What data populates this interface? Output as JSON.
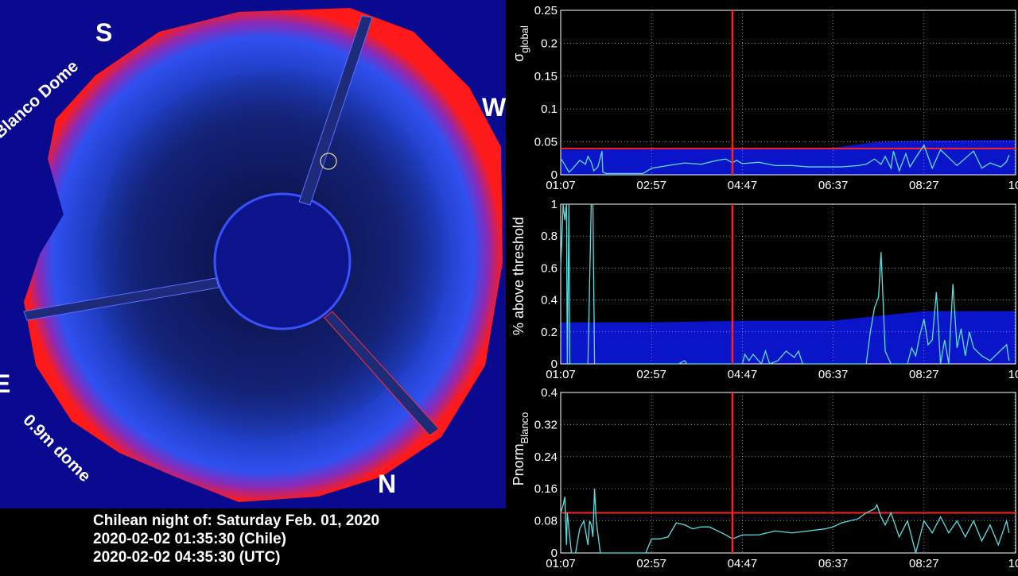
{
  "sky_image": {
    "labels": {
      "south": "S",
      "west": "W",
      "east": "E",
      "north": "N",
      "blanco_dome": "Blanco Dome",
      "small_dome": "0.9m dome"
    }
  },
  "caption": {
    "line1": "Chilean night of: Saturday Feb. 01, 2020",
    "line2": "2020-02-02 01:35:30 (Chile)",
    "line3": "2020-02-02 04:35:30 (UTC)"
  },
  "colors": {
    "background": "#000000",
    "series": "#58e0e0",
    "fill": "#0a14c8",
    "marker": "#ff2020",
    "grid": "#ffffff"
  },
  "chart_data": [
    {
      "type": "area",
      "ylabel": "σglobal",
      "ylabel_main": "σ",
      "ylabel_sub": "global",
      "xticks": [
        "01:07",
        "02:57",
        "04:47",
        "06:37",
        "08:27",
        "10"
      ],
      "yticks": [
        "0",
        "0.05",
        "0.1",
        "0.15",
        "0.2",
        "0.25"
      ],
      "ylim": [
        0,
        0.25
      ],
      "grid": true,
      "current_time": "04:35",
      "threshold": 0.04,
      "envelope": {
        "x": [
          "01:07",
          "02:57",
          "04:47",
          "06:37",
          "07:30",
          "08:27",
          "10:10"
        ],
        "y": [
          0.038,
          0.039,
          0.04,
          0.041,
          0.05,
          0.052,
          0.053
        ]
      },
      "series": {
        "x": [
          "01:07",
          "01:12",
          "01:17",
          "01:22",
          "01:30",
          "01:37",
          "01:40",
          "01:44",
          "01:47",
          "01:52",
          "01:57",
          "01:58",
          "02:02",
          "02:07",
          "02:12",
          "02:17",
          "02:27",
          "02:37",
          "02:47",
          "02:57",
          "03:17",
          "03:37",
          "03:57",
          "04:17",
          "04:27",
          "04:35",
          "04:40",
          "04:47",
          "05:07",
          "05:27",
          "05:47",
          "06:07",
          "06:27",
          "06:47",
          "07:07",
          "07:17",
          "07:27",
          "07:35",
          "07:40",
          "07:47",
          "07:50",
          "07:57",
          "08:05",
          "08:10",
          "08:17",
          "08:27",
          "08:37",
          "08:47",
          "09:07",
          "09:27",
          "09:37",
          "09:47",
          "10:00",
          "10:07",
          "10:10"
        ],
        "y": [
          0.025,
          0.015,
          0.004,
          0.01,
          0.022,
          0.016,
          0.028,
          0.019,
          0.006,
          0.012,
          0.036,
          0.004,
          0.002,
          0.002,
          0.002,
          0.002,
          0.002,
          0.002,
          0.002,
          0.01,
          0.014,
          0.018,
          0.016,
          0.022,
          0.024,
          0.018,
          0.022,
          0.017,
          0.019,
          0.014,
          0.014,
          0.012,
          0.012,
          0.012,
          0.014,
          0.016,
          0.024,
          0.016,
          0.028,
          0.01,
          0.036,
          0.006,
          0.032,
          0.012,
          0.026,
          0.045,
          0.01,
          0.038,
          0.014,
          0.036,
          0.01,
          0.018,
          0.012,
          0.02,
          0.03
        ]
      }
    },
    {
      "type": "area",
      "ylabel": "% above threshold",
      "xticks": [
        "01:07",
        "02:57",
        "04:47",
        "06:37",
        "08:27",
        "10"
      ],
      "yticks": [
        "0",
        "0.2",
        "0.4",
        "0.6",
        "0.8",
        "1"
      ],
      "ylim": [
        0,
        1
      ],
      "grid": true,
      "current_time": "04:35",
      "envelope": {
        "x": [
          "01:07",
          "02:57",
          "04:47",
          "06:37",
          "07:30",
          "08:27",
          "10:10"
        ],
        "y": [
          0.26,
          0.26,
          0.27,
          0.27,
          0.3,
          0.33,
          0.33
        ]
      },
      "series": {
        "x": [
          "01:07",
          "01:10",
          "01:12",
          "01:14",
          "01:15",
          "01:17",
          "01:18",
          "01:22",
          "01:40",
          "01:44",
          "01:46",
          "01:48",
          "01:50",
          "02:57",
          "03:30",
          "03:37",
          "03:40",
          "04:47",
          "04:50",
          "04:55",
          "05:00",
          "05:10",
          "05:15",
          "05:20",
          "05:30",
          "05:40",
          "05:50",
          "05:55",
          "06:00",
          "06:10",
          "06:37",
          "07:17",
          "07:22",
          "07:27",
          "07:32",
          "07:35",
          "07:40",
          "07:47",
          "07:57",
          "08:07",
          "08:12",
          "08:17",
          "08:22",
          "08:27",
          "08:32",
          "08:37",
          "08:42",
          "08:47",
          "08:52",
          "08:57",
          "09:02",
          "09:07",
          "09:12",
          "09:17",
          "09:22",
          "09:27",
          "09:37",
          "09:47",
          "10:07",
          "10:10"
        ],
        "y": [
          0.6,
          1.0,
          0.9,
          1.0,
          0.0,
          1.0,
          0.0,
          0.0,
          0.0,
          1.0,
          1.0,
          0.0,
          0.0,
          0.0,
          0.0,
          0.02,
          0.0,
          0.0,
          0.06,
          0.02,
          0.06,
          0.0,
          0.08,
          0.0,
          0.02,
          0.08,
          0.04,
          0.08,
          0.0,
          0.0,
          0.0,
          0.0,
          0.2,
          0.35,
          0.42,
          0.7,
          0.08,
          0.0,
          0.0,
          0.0,
          0.1,
          0.05,
          0.18,
          0.28,
          0.12,
          0.15,
          0.45,
          0.0,
          0.15,
          0.0,
          0.5,
          0.1,
          0.22,
          0.05,
          0.2,
          0.1,
          0.05,
          0.02,
          0.12,
          0.02
        ]
      }
    },
    {
      "type": "line",
      "ylabel": "PnormBlanco",
      "ylabel_main": "Pnorm",
      "ylabel_sub": "Blanco",
      "xticks": [
        "01:07",
        "02:57",
        "04:47",
        "06:37",
        "08:27",
        "10"
      ],
      "yticks": [
        "0",
        "0.08",
        "0.16",
        "0.24",
        "0.32",
        "0.4"
      ],
      "ylim": [
        0,
        0.4
      ],
      "grid": true,
      "current_time": "04:35",
      "threshold": 0.1,
      "series": {
        "x": [
          "01:07",
          "01:10",
          "01:12",
          "01:14",
          "01:15",
          "01:20",
          "01:25",
          "01:30",
          "01:35",
          "01:40",
          "01:42",
          "01:44",
          "01:46",
          "01:48",
          "01:50",
          "01:55",
          "02:00",
          "02:05",
          "02:10",
          "02:20",
          "02:30",
          "02:40",
          "02:50",
          "02:57",
          "03:07",
          "03:17",
          "03:27",
          "03:37",
          "03:47",
          "03:57",
          "04:07",
          "04:17",
          "04:27",
          "04:35",
          "04:47",
          "05:07",
          "05:27",
          "05:47",
          "06:07",
          "06:27",
          "06:37",
          "06:47",
          "07:07",
          "07:17",
          "07:27",
          "07:30",
          "07:35",
          "07:40",
          "07:47",
          "07:57",
          "08:07",
          "08:17",
          "08:27",
          "08:37",
          "08:47",
          "08:57",
          "09:07",
          "09:17",
          "09:27",
          "09:37",
          "09:47",
          "09:57",
          "10:07",
          "10:10"
        ],
        "y": [
          0.1,
          0.12,
          0.14,
          0.02,
          0.1,
          0.0,
          0.0,
          0.06,
          0.08,
          0.02,
          0.08,
          0.07,
          0.04,
          0.16,
          0.08,
          0.0,
          0.0,
          0.0,
          0.0,
          0.0,
          0.0,
          0.0,
          0.0,
          0.035,
          0.035,
          0.04,
          0.075,
          0.07,
          0.06,
          0.065,
          0.065,
          0.055,
          0.045,
          0.035,
          0.045,
          0.045,
          0.055,
          0.05,
          0.055,
          0.06,
          0.065,
          0.075,
          0.085,
          0.1,
          0.11,
          0.12,
          0.09,
          0.07,
          0.1,
          0.04,
          0.08,
          0.0,
          0.08,
          0.05,
          0.09,
          0.05,
          0.08,
          0.04,
          0.08,
          0.03,
          0.07,
          0.02,
          0.08,
          0.05
        ]
      }
    }
  ]
}
